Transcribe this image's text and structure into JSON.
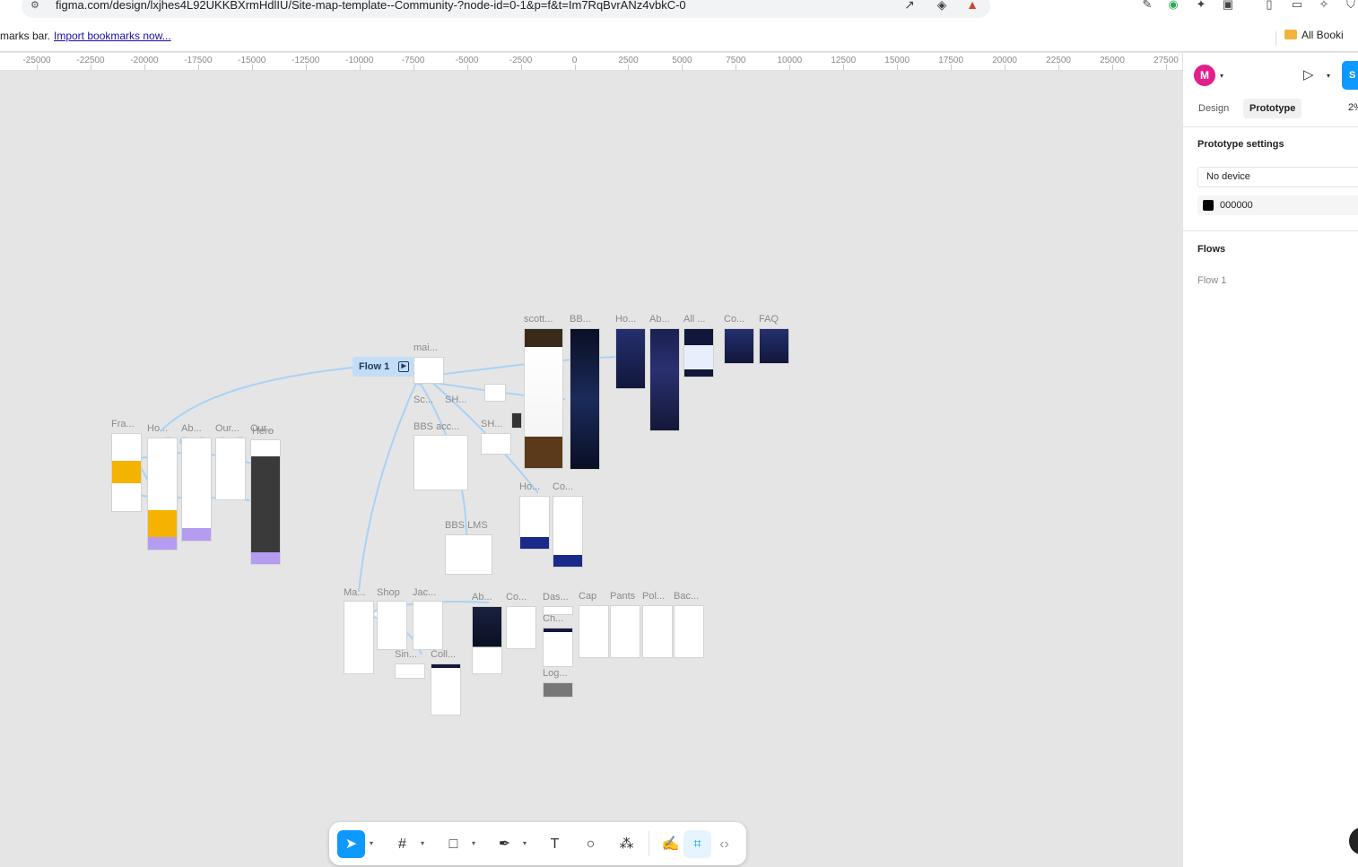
{
  "browser": {
    "url": "figma.com/design/lxjhes4L92UKKBXrmHdlIU/Site-map-template--Community-?node-id=0-1&p=f&t=Im7RqBvrANz4vbkC-0",
    "bookmarks_prefix": "marks bar.",
    "import_link": "Import bookmarks now...",
    "all_bookmarks": "All Booki"
  },
  "ruler": {
    "ticks": [
      "-25000",
      "-22500",
      "-20000",
      "-17500",
      "-15000",
      "-12500",
      "-10000",
      "-7500",
      "-5000",
      "-2500",
      "0",
      "2500",
      "5000",
      "7500",
      "10000",
      "12500",
      "15000",
      "17500",
      "20000",
      "22500",
      "25000",
      "27500"
    ]
  },
  "canvas": {
    "flow_tag": "Flow 1",
    "frame_labels": [
      "scott...",
      "BB...",
      "Ho...",
      "Ab...",
      "All ...",
      "Co...",
      "FAQ",
      "mai...",
      "Fra...",
      "Ho...",
      "Ab...",
      "Our...",
      "Our...",
      "Hero",
      "Sc...",
      "SH...",
      "BBS acc...",
      "SH...",
      "Ho...",
      "Co...",
      "BBS LMS",
      "Ma...",
      "Shop",
      "Jac...",
      "Ab...",
      "Co...",
      "Das...",
      "Cap",
      "Pants",
      "Pol...",
      "Bac...",
      "Ch...",
      "Sin...",
      "Coll...",
      "Log..."
    ]
  },
  "panel": {
    "avatar_letter": "M",
    "share_label": "S",
    "tabs": [
      "Design",
      "Prototype"
    ],
    "zoom": "2%",
    "prototype_settings_title": "Prototype settings",
    "device_value": "No device",
    "background_hex": "000000",
    "flows_title": "Flows",
    "flows": [
      "Flow 1"
    ]
  },
  "colors": {
    "accent": "#0d99ff",
    "avatar": "#e0208c",
    "canvas": "#e5e5e5",
    "connector": "#a9d2f5"
  },
  "toolbar": {
    "tools": [
      "move-tool",
      "frame-tool",
      "shape-tool",
      "pen-tool",
      "text-tool",
      "comment-tool",
      "actions-tool",
      "draw-mode",
      "dev-mode-flow",
      "dev-mode"
    ]
  }
}
